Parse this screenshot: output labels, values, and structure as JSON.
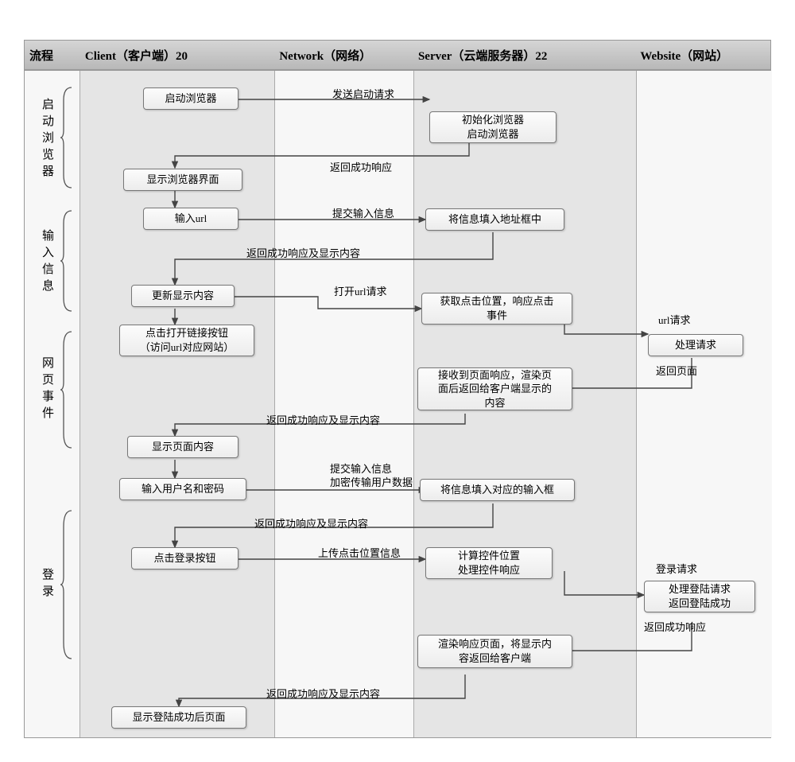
{
  "headers": {
    "process": "流程",
    "client": "Client（客户端）20",
    "network": "Network（网络）",
    "server": "Server（云端服务器）22",
    "website": "Website（网站）"
  },
  "phases": {
    "p1": "启动浏览器",
    "p2": "输入信息",
    "p3": "网页事件",
    "p4": "登录"
  },
  "nodes": {
    "n1": "启动浏览器",
    "n2": "初始化浏览器\n启动浏览器",
    "n3": "显示浏览器界面",
    "n4": "输入url",
    "n5": "将信息填入地址框中",
    "n6": "更新显示内容",
    "n7": "点击打开链接按钮\n（访问url对应网站）",
    "n8": "获取点击位置，响应点击\n事件",
    "n9": "处理请求",
    "n10": "接收到页面响应，渲染页\n面后返回给客户端显示的\n内容",
    "n11": "显示页面内容",
    "n12": "输入用户名和密码",
    "n13": "将信息填入对应的输入框",
    "n14": "点击登录按钮",
    "n15": "计算控件位置\n处理控件响应",
    "n16": "处理登陆请求\n返回登陆成功",
    "n17": "渲染响应页面，将显示内\n容返回给客户端",
    "n18": "显示登陆成功后页面"
  },
  "labels": {
    "l1": "发送启动请求",
    "l2": "返回成功响应",
    "l3": "提交输入信息",
    "l4": "返回成功响应及显示内容",
    "l5": "打开url请求",
    "l6": "url请求",
    "l7": "返回页面",
    "l8": "返回成功响应及显示内容",
    "l9": "提交输入信息\n加密传输用户数据",
    "l10": "返回成功响应及显示内容",
    "l11": "上传点击位置信息",
    "l12": "登录请求",
    "l13": "返回成功响应",
    "l14": "返回成功响应及显示内容"
  },
  "chart_data": {
    "type": "flow-swimlane",
    "lanes": [
      {
        "id": "process",
        "label": "流程"
      },
      {
        "id": "client",
        "label": "Client（客户端）20"
      },
      {
        "id": "network",
        "label": "Network（网络）"
      },
      {
        "id": "server",
        "label": "Server（云端服务器）22"
      },
      {
        "id": "website",
        "label": "Website（网站）"
      }
    ],
    "phases": [
      {
        "id": "p1",
        "label": "启动浏览器"
      },
      {
        "id": "p2",
        "label": "输入信息"
      },
      {
        "id": "p3",
        "label": "网页事件"
      },
      {
        "id": "p4",
        "label": "登录"
      }
    ],
    "nodes": [
      {
        "id": "n1",
        "lane": "client",
        "phase": "p1",
        "text": "启动浏览器"
      },
      {
        "id": "n2",
        "lane": "server",
        "phase": "p1",
        "text": "初始化浏览器 启动浏览器"
      },
      {
        "id": "n3",
        "lane": "client",
        "phase": "p1",
        "text": "显示浏览器界面"
      },
      {
        "id": "n4",
        "lane": "client",
        "phase": "p2",
        "text": "输入url"
      },
      {
        "id": "n5",
        "lane": "server",
        "phase": "p2",
        "text": "将信息填入地址框中"
      },
      {
        "id": "n6",
        "lane": "client",
        "phase": "p2",
        "text": "更新显示内容"
      },
      {
        "id": "n7",
        "lane": "client",
        "phase": "p3",
        "text": "点击打开链接按钮（访问url对应网站）"
      },
      {
        "id": "n8",
        "lane": "server",
        "phase": "p3",
        "text": "获取点击位置，响应点击事件"
      },
      {
        "id": "n9",
        "lane": "website",
        "phase": "p3",
        "text": "处理请求"
      },
      {
        "id": "n10",
        "lane": "server",
        "phase": "p3",
        "text": "接收到页面响应，渲染页面后返回给客户端显示的内容"
      },
      {
        "id": "n11",
        "lane": "client",
        "phase": "p3",
        "text": "显示页面内容"
      },
      {
        "id": "n12",
        "lane": "client",
        "phase": "p4",
        "text": "输入用户名和密码"
      },
      {
        "id": "n13",
        "lane": "server",
        "phase": "p4",
        "text": "将信息填入对应的输入框"
      },
      {
        "id": "n14",
        "lane": "client",
        "phase": "p4",
        "text": "点击登录按钮"
      },
      {
        "id": "n15",
        "lane": "server",
        "phase": "p4",
        "text": "计算控件位置 处理控件响应"
      },
      {
        "id": "n16",
        "lane": "website",
        "phase": "p4",
        "text": "处理登陆请求 返回登陆成功"
      },
      {
        "id": "n17",
        "lane": "server",
        "phase": "p4",
        "text": "渲染响应页面，将显示内容返回给客户端"
      },
      {
        "id": "n18",
        "lane": "client",
        "phase": "p4",
        "text": "显示登陆成功后页面"
      }
    ],
    "edges": [
      {
        "from": "n1",
        "to": "n2",
        "label": "发送启动请求"
      },
      {
        "from": "n2",
        "to": "n3",
        "label": "返回成功响应"
      },
      {
        "from": "n3",
        "to": "n4"
      },
      {
        "from": "n4",
        "to": "n5",
        "label": "提交输入信息"
      },
      {
        "from": "n5",
        "to": "n6",
        "label": "返回成功响应及显示内容"
      },
      {
        "from": "n6",
        "to": "n7"
      },
      {
        "from": "n7",
        "to": "n8",
        "label": "打开url请求"
      },
      {
        "from": "n8",
        "to": "n9",
        "label": "url请求"
      },
      {
        "from": "n9",
        "to": "n10",
        "label": "返回页面"
      },
      {
        "from": "n10",
        "to": "n11",
        "label": "返回成功响应及显示内容"
      },
      {
        "from": "n11",
        "to": "n12"
      },
      {
        "from": "n12",
        "to": "n13",
        "label": "提交输入信息 加密传输用户数据"
      },
      {
        "from": "n13",
        "to": "n14",
        "label": "返回成功响应及显示内容"
      },
      {
        "from": "n14",
        "to": "n15",
        "label": "上传点击位置信息"
      },
      {
        "from": "n15",
        "to": "n16",
        "label": "登录请求"
      },
      {
        "from": "n16",
        "to": "n17",
        "label": "返回成功响应"
      },
      {
        "from": "n17",
        "to": "n18",
        "label": "返回成功响应及显示内容"
      }
    ]
  }
}
